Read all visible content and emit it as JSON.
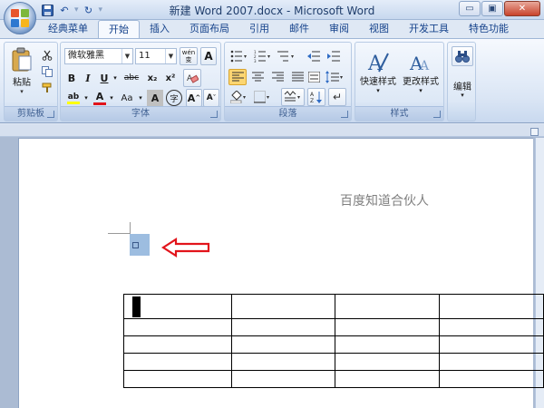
{
  "window": {
    "title": "新建 Word 2007.docx - Microsoft Word",
    "controls": {
      "minimize": "▭",
      "restore": "▣",
      "close": "✕"
    }
  },
  "quick_access": {
    "undo": "↶",
    "redo": "↻",
    "more": "▾"
  },
  "tabs": [
    {
      "label": "经典菜单"
    },
    {
      "label": "开始"
    },
    {
      "label": "插入"
    },
    {
      "label": "页面布局"
    },
    {
      "label": "引用"
    },
    {
      "label": "邮件"
    },
    {
      "label": "审阅"
    },
    {
      "label": "视图"
    },
    {
      "label": "开发工具"
    },
    {
      "label": "特色功能"
    }
  ],
  "ribbon": {
    "clipboard": {
      "label": "剪贴板",
      "paste": "粘贴"
    },
    "font": {
      "label": "字体",
      "font_name": "微软雅黑",
      "font_size": "11",
      "phonetic": "wén 变",
      "border_char": "A",
      "bold": "B",
      "italic": "I",
      "underline": "U",
      "strike": "abc",
      "subscript": "x₂",
      "superscript": "x²",
      "highlight": "ab",
      "font_color": "A",
      "change_case": "Aa",
      "shading": "A",
      "enclose": "字",
      "grow": "A",
      "shrink": "A"
    },
    "paragraph": {
      "label": "段落"
    },
    "styles": {
      "label": "样式",
      "quick_styles": "快速样式",
      "change_styles": "更改样式",
      "glyph": "A"
    },
    "editing": {
      "label": "编辑"
    }
  },
  "document": {
    "header_text": "百度知道合伙人"
  },
  "colors": {
    "accent": "#15428b",
    "ribbon_bg": "#dbe6f5",
    "arrow": "#e2141b",
    "selection": "#9dbde0"
  }
}
